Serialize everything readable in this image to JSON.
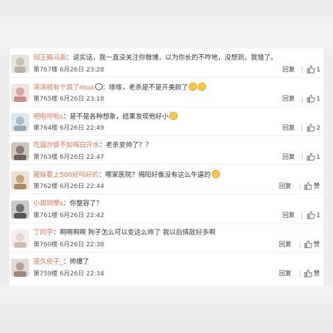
{
  "comments": [
    {
      "user": "阎王殿马面",
      "text": "：说实话，我一直没关注你微博，以为你长的不咋地，没想到，我错了。",
      "floor": "第767楼",
      "date": "6月26日",
      "time": "23:28",
      "reply": "回复",
      "likes": "1",
      "avatar_color": "#c9c2b4",
      "emoji": ""
    },
    {
      "user": "清清就有个其了mua",
      "text": "：咳咳，老杀是不是开美颜了",
      "floor": "第765楼",
      "date": "6月26日",
      "time": "23:18",
      "reply": "回复",
      "likes": "1",
      "avatar_color": "#d6a7a0",
      "emoji": "panda+smile"
    },
    {
      "user": "吧啦呼啦s",
      "text": "：是不是各种想象，结果发现他好小",
      "floor": "第764楼",
      "date": "6月26日",
      "time": "22:49",
      "reply": "回复",
      "likes": "2",
      "avatar_color": "#a9bcc7",
      "emoji": "laugh"
    },
    {
      "user": "吃届炒饭不如喝白开水",
      "text": "：老杀变帅了？？",
      "floor": "第763楼",
      "date": "6月26日",
      "time": "22:47",
      "reply": "回复",
      "likes": "1",
      "avatar_color": "#8a7a74",
      "emoji": ""
    },
    {
      "user": "猩妹要上500好吗好的",
      "text": "：哪家医院？揭阳好像没有这么牛逼的",
      "floor": "第762楼",
      "date": "6月26日",
      "time": "22:44",
      "reply": "回复",
      "likes": "赞",
      "avatar_color": "#c2a27f",
      "emoji": "dog"
    },
    {
      "user": "小周同學s",
      "text": "：你整容了？",
      "floor": "第761楼",
      "date": "6月26日",
      "time": "22:42",
      "reply": "回复",
      "likes": "1",
      "avatar_color": "#6d6f6c",
      "emoji": ""
    },
    {
      "user": "丁同学",
      "text": "：啊啊啊啊  狗子怎么可以变这么帅了  我以后情敌好多啊",
      "floor": "第760楼",
      "date": "6月26日",
      "time": "22:38",
      "reply": "回复",
      "likes": "赞",
      "avatar_color": "#e6d3cf",
      "emoji": ""
    },
    {
      "user": "壹久依子_",
      "text": "：帅爆了",
      "floor": "第759楼",
      "date": "6月26日",
      "time": "22:34",
      "reply": "回复",
      "likes": "赞",
      "avatar_color": "#b8a49a",
      "emoji": ""
    }
  ],
  "colors": {
    "username": "#eb7350",
    "text": "#333333",
    "meta": "#555555"
  },
  "icons": {
    "like": "thumbs-up-icon"
  }
}
